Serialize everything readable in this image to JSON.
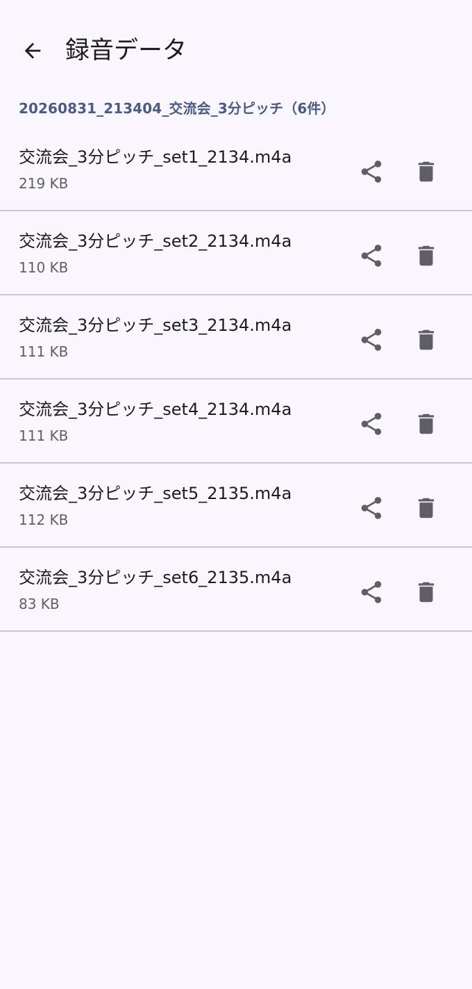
{
  "header": {
    "back_icon": "arrow-back-icon",
    "title": "録音データ"
  },
  "group": {
    "label": "20260831_213404_交流会_3分ピッチ（6件）"
  },
  "files": [
    {
      "name": "交流会_3分ピッチ_set1_2134.m4a",
      "size": "219 KB"
    },
    {
      "name": "交流会_3分ピッチ_set2_2134.m4a",
      "size": "110 KB"
    },
    {
      "name": "交流会_3分ピッチ_set3_2134.m4a",
      "size": "111 KB"
    },
    {
      "name": "交流会_3分ピッチ_set4_2134.m4a",
      "size": "111 KB"
    },
    {
      "name": "交流会_3分ピッチ_set5_2135.m4a",
      "size": "112 KB"
    },
    {
      "name": "交流会_3分ピッチ_set6_2135.m4a",
      "size": "83 KB"
    }
  ],
  "icons": {
    "share": "share-icon",
    "delete": "trash-icon"
  },
  "colors": {
    "background": "#f9f7fd",
    "group_header": "#4b5b84",
    "icon": "#5f5d66",
    "divider": "#c9c6cc"
  }
}
